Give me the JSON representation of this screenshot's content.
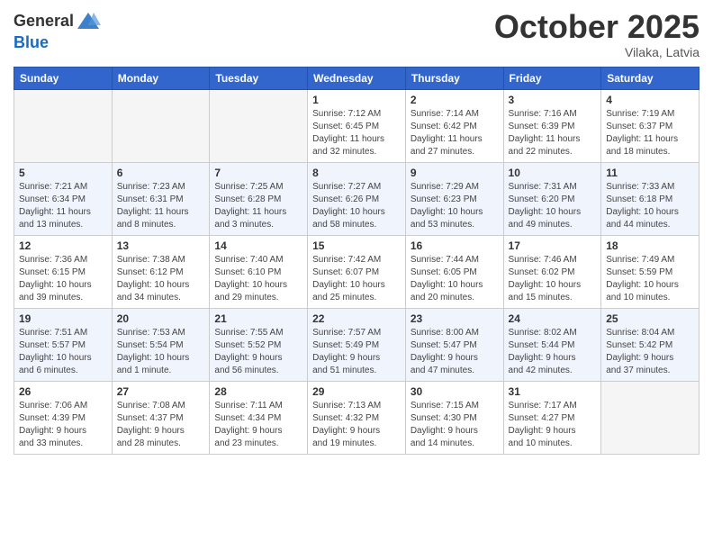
{
  "header": {
    "logo_general": "General",
    "logo_blue": "Blue",
    "month": "October 2025",
    "location": "Vilaka, Latvia"
  },
  "weekdays": [
    "Sunday",
    "Monday",
    "Tuesday",
    "Wednesday",
    "Thursday",
    "Friday",
    "Saturday"
  ],
  "weeks": [
    [
      {
        "day": "",
        "info": ""
      },
      {
        "day": "",
        "info": ""
      },
      {
        "day": "",
        "info": ""
      },
      {
        "day": "1",
        "info": "Sunrise: 7:12 AM\nSunset: 6:45 PM\nDaylight: 11 hours\nand 32 minutes."
      },
      {
        "day": "2",
        "info": "Sunrise: 7:14 AM\nSunset: 6:42 PM\nDaylight: 11 hours\nand 27 minutes."
      },
      {
        "day": "3",
        "info": "Sunrise: 7:16 AM\nSunset: 6:39 PM\nDaylight: 11 hours\nand 22 minutes."
      },
      {
        "day": "4",
        "info": "Sunrise: 7:19 AM\nSunset: 6:37 PM\nDaylight: 11 hours\nand 18 minutes."
      }
    ],
    [
      {
        "day": "5",
        "info": "Sunrise: 7:21 AM\nSunset: 6:34 PM\nDaylight: 11 hours\nand 13 minutes."
      },
      {
        "day": "6",
        "info": "Sunrise: 7:23 AM\nSunset: 6:31 PM\nDaylight: 11 hours\nand 8 minutes."
      },
      {
        "day": "7",
        "info": "Sunrise: 7:25 AM\nSunset: 6:28 PM\nDaylight: 11 hours\nand 3 minutes."
      },
      {
        "day": "8",
        "info": "Sunrise: 7:27 AM\nSunset: 6:26 PM\nDaylight: 10 hours\nand 58 minutes."
      },
      {
        "day": "9",
        "info": "Sunrise: 7:29 AM\nSunset: 6:23 PM\nDaylight: 10 hours\nand 53 minutes."
      },
      {
        "day": "10",
        "info": "Sunrise: 7:31 AM\nSunset: 6:20 PM\nDaylight: 10 hours\nand 49 minutes."
      },
      {
        "day": "11",
        "info": "Sunrise: 7:33 AM\nSunset: 6:18 PM\nDaylight: 10 hours\nand 44 minutes."
      }
    ],
    [
      {
        "day": "12",
        "info": "Sunrise: 7:36 AM\nSunset: 6:15 PM\nDaylight: 10 hours\nand 39 minutes."
      },
      {
        "day": "13",
        "info": "Sunrise: 7:38 AM\nSunset: 6:12 PM\nDaylight: 10 hours\nand 34 minutes."
      },
      {
        "day": "14",
        "info": "Sunrise: 7:40 AM\nSunset: 6:10 PM\nDaylight: 10 hours\nand 29 minutes."
      },
      {
        "day": "15",
        "info": "Sunrise: 7:42 AM\nSunset: 6:07 PM\nDaylight: 10 hours\nand 25 minutes."
      },
      {
        "day": "16",
        "info": "Sunrise: 7:44 AM\nSunset: 6:05 PM\nDaylight: 10 hours\nand 20 minutes."
      },
      {
        "day": "17",
        "info": "Sunrise: 7:46 AM\nSunset: 6:02 PM\nDaylight: 10 hours\nand 15 minutes."
      },
      {
        "day": "18",
        "info": "Sunrise: 7:49 AM\nSunset: 5:59 PM\nDaylight: 10 hours\nand 10 minutes."
      }
    ],
    [
      {
        "day": "19",
        "info": "Sunrise: 7:51 AM\nSunset: 5:57 PM\nDaylight: 10 hours\nand 6 minutes."
      },
      {
        "day": "20",
        "info": "Sunrise: 7:53 AM\nSunset: 5:54 PM\nDaylight: 10 hours\nand 1 minute."
      },
      {
        "day": "21",
        "info": "Sunrise: 7:55 AM\nSunset: 5:52 PM\nDaylight: 9 hours\nand 56 minutes."
      },
      {
        "day": "22",
        "info": "Sunrise: 7:57 AM\nSunset: 5:49 PM\nDaylight: 9 hours\nand 51 minutes."
      },
      {
        "day": "23",
        "info": "Sunrise: 8:00 AM\nSunset: 5:47 PM\nDaylight: 9 hours\nand 47 minutes."
      },
      {
        "day": "24",
        "info": "Sunrise: 8:02 AM\nSunset: 5:44 PM\nDaylight: 9 hours\nand 42 minutes."
      },
      {
        "day": "25",
        "info": "Sunrise: 8:04 AM\nSunset: 5:42 PM\nDaylight: 9 hours\nand 37 minutes."
      }
    ],
    [
      {
        "day": "26",
        "info": "Sunrise: 7:06 AM\nSunset: 4:39 PM\nDaylight: 9 hours\nand 33 minutes."
      },
      {
        "day": "27",
        "info": "Sunrise: 7:08 AM\nSunset: 4:37 PM\nDaylight: 9 hours\nand 28 minutes."
      },
      {
        "day": "28",
        "info": "Sunrise: 7:11 AM\nSunset: 4:34 PM\nDaylight: 9 hours\nand 23 minutes."
      },
      {
        "day": "29",
        "info": "Sunrise: 7:13 AM\nSunset: 4:32 PM\nDaylight: 9 hours\nand 19 minutes."
      },
      {
        "day": "30",
        "info": "Sunrise: 7:15 AM\nSunset: 4:30 PM\nDaylight: 9 hours\nand 14 minutes."
      },
      {
        "day": "31",
        "info": "Sunrise: 7:17 AM\nSunset: 4:27 PM\nDaylight: 9 hours\nand 10 minutes."
      },
      {
        "day": "",
        "info": ""
      }
    ]
  ]
}
